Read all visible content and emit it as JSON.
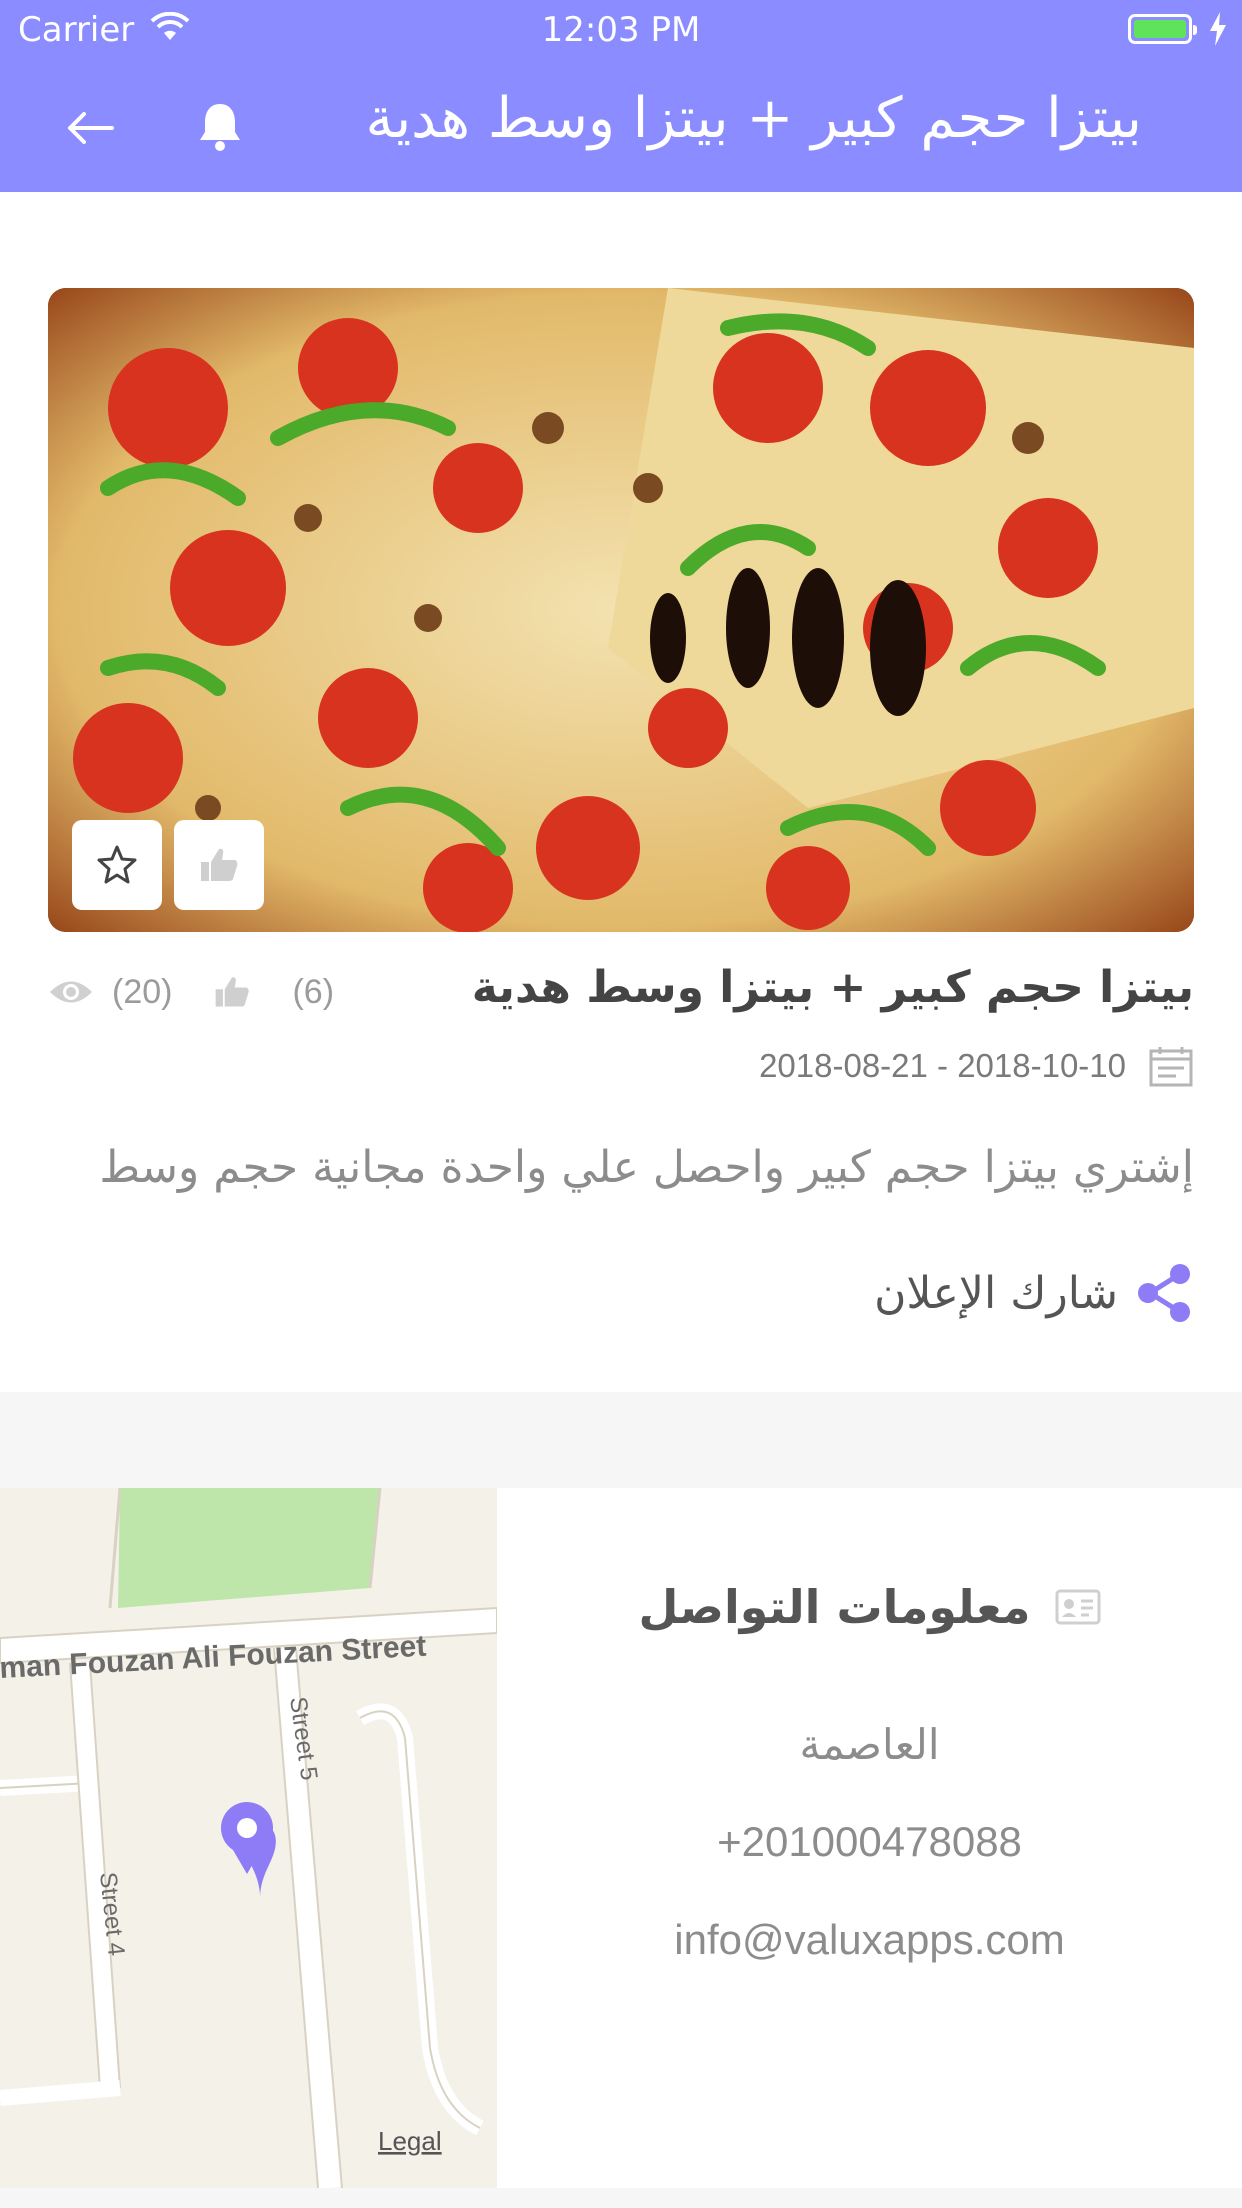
{
  "status_bar": {
    "carrier": "Carrier",
    "time": "12:03 PM"
  },
  "nav": {
    "title": "بيتزا حجم كبير + بيتزا وسط هدية",
    "back_icon": "arrow-left-icon",
    "bell_icon": "bell-icon"
  },
  "offer": {
    "title": "بيتزا حجم كبير + بيتزا وسط هدية",
    "views": "(20)",
    "likes": "(6)",
    "date_range": "2018-08-21 - 2018-10-10",
    "description": "إشتري بيتزا حجم كبير واحصل علي واحدة مجانية حجم وسط",
    "share_label": "شارك الإعلان"
  },
  "contact": {
    "title": "معلومات التواصل",
    "city": "العاصمة",
    "phone": "+201000478088",
    "email": "info@valuxapps.com"
  },
  "map": {
    "street_main": "man Fouzan Ali Fouzan Street",
    "street_5": "Street 5",
    "street_4": "Street 4",
    "legal": "Legal"
  },
  "colors": {
    "accent": "#8a8cff",
    "pin": "#8d7cf5"
  }
}
